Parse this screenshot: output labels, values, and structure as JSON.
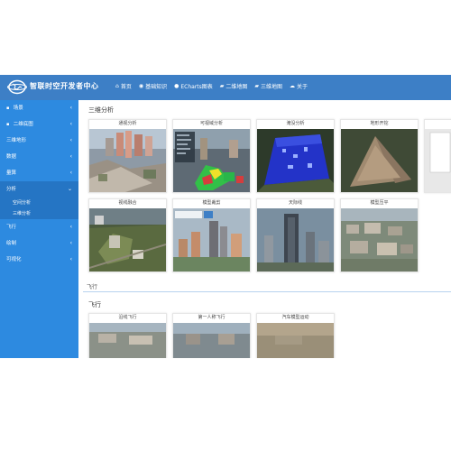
{
  "header": {
    "title": "智联时空开发者中心",
    "nav": [
      {
        "icon": "home-icon",
        "label": "首页"
      },
      {
        "icon": "eye-icon",
        "label": "基础知识"
      },
      {
        "icon": "echarts-icon",
        "label": "ECharts图表"
      },
      {
        "icon": "map-icon",
        "label": "二维地图"
      },
      {
        "icon": "map-icon",
        "label": "三维地图"
      },
      {
        "icon": "cloud-icon",
        "label": "关于"
      }
    ]
  },
  "sidebar": {
    "items": [
      {
        "label": "场景"
      },
      {
        "label": "二维底图"
      },
      {
        "label": "三维地形"
      },
      {
        "label": "数据"
      },
      {
        "label": "量算"
      },
      {
        "label": "分析"
      },
      {
        "label": "飞行"
      },
      {
        "label": "绘制"
      },
      {
        "label": "可视化"
      }
    ],
    "subitems": [
      {
        "label": "空间分析"
      },
      {
        "label": "三维分析"
      }
    ]
  },
  "content": {
    "section1_title": "三维分析",
    "cards1": [
      {
        "title": "通视分析"
      },
      {
        "title": "可视域分析"
      },
      {
        "title": "淹没分析"
      },
      {
        "title": "地形开挖"
      },
      {
        "title": "视线融合"
      },
      {
        "title": "模型裁剪"
      },
      {
        "title": "天际线"
      },
      {
        "title": "模型压平"
      }
    ],
    "divider_label": "飞行",
    "section2_title": "飞行",
    "cards2": [
      {
        "title": "沿线飞行"
      },
      {
        "title": "第一人称飞行"
      },
      {
        "title": "汽车模型运动"
      }
    ]
  }
}
